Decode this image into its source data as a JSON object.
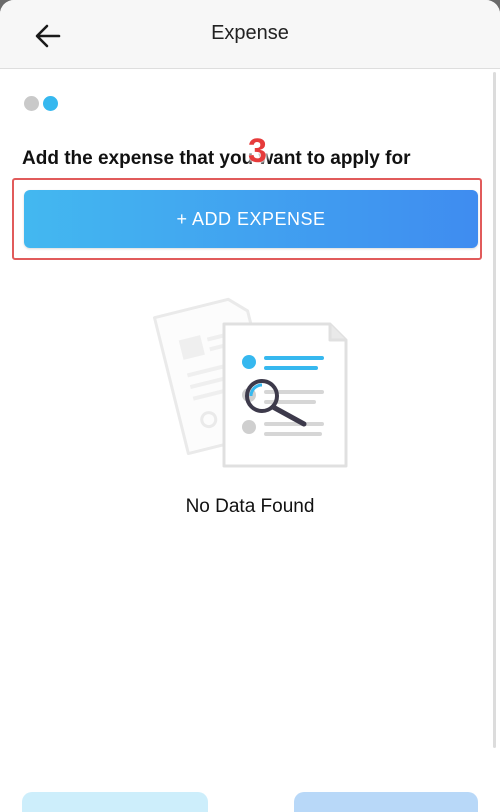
{
  "header": {
    "title": "Expense",
    "back_icon": "arrow-left-icon"
  },
  "progress": {
    "steps_total": 2,
    "current_step": 2,
    "active_color": "#36b8ef",
    "inactive_color": "#c9c9c9"
  },
  "instruction": {
    "text": "Add the expense that you want to apply for"
  },
  "annotation": {
    "step_number": "3",
    "color": "#e63b3b"
  },
  "add_button": {
    "label": "+ ADD EXPENSE",
    "gradient_start": "#43b8f0",
    "gradient_end": "#3f8cf0"
  },
  "empty_state": {
    "icon": "no-data-document-search-icon",
    "message": "No Data Found"
  },
  "footer": {
    "left_button_color": "#cdeefb",
    "right_button_color": "#b8d8f8"
  }
}
